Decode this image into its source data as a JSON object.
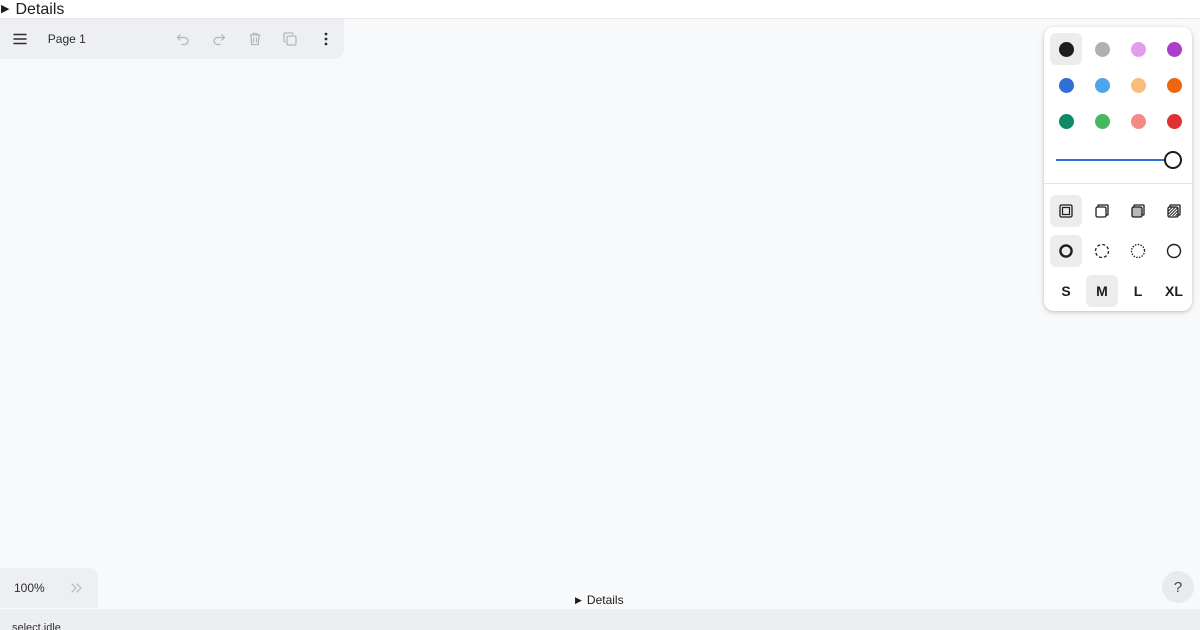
{
  "top_details": {
    "label": "Details"
  },
  "menu": {
    "page_name": "Page 1"
  },
  "style_panel": {
    "colors": [
      {
        "name": "black",
        "hex": "#1d1d1d",
        "selected": true
      },
      {
        "name": "grey",
        "hex": "#adb0b4",
        "selected": false
      },
      {
        "name": "light-violet",
        "hex": "#e59bee",
        "selected": false
      },
      {
        "name": "violet",
        "hex": "#ad3dcb",
        "selected": false
      },
      {
        "name": "blue",
        "hex": "#2f6fd6",
        "selected": false
      },
      {
        "name": "light-blue",
        "hex": "#4fa4ef",
        "selected": false
      },
      {
        "name": "yellow",
        "hex": "#f7bd7c",
        "selected": false
      },
      {
        "name": "orange",
        "hex": "#f0660d",
        "selected": false
      },
      {
        "name": "green",
        "hex": "#0d8a67",
        "selected": false
      },
      {
        "name": "light-green",
        "hex": "#46b960",
        "selected": false
      },
      {
        "name": "light-red",
        "hex": "#f38a86",
        "selected": false
      },
      {
        "name": "red",
        "hex": "#e03131",
        "selected": false
      }
    ],
    "opacity": 1.0,
    "fills": [
      "fill-none",
      "fill-semi",
      "fill-solid",
      "fill-pattern"
    ],
    "dashes": [
      "dash-draw",
      "dash-dashed",
      "dash-dotted",
      "dash-solid"
    ],
    "sizes": {
      "s": "S",
      "m": "M",
      "l": "L",
      "xl": "XL"
    }
  },
  "zoom": {
    "value": "100%"
  },
  "bottom_details": {
    "label": "Details"
  },
  "help": {
    "label": "?"
  },
  "status": {
    "text": "select.idle"
  }
}
